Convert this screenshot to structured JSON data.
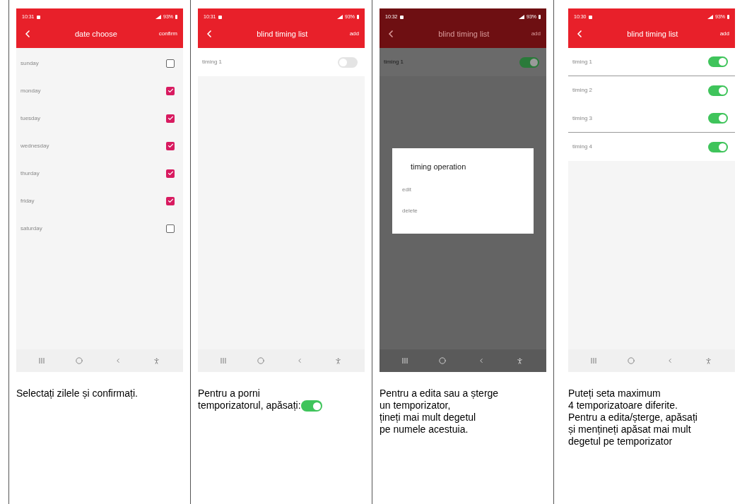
{
  "panels": [
    {
      "kind": "days",
      "dimmed": false,
      "status": {
        "time": "10:31",
        "battery": "93%"
      },
      "header": {
        "title": "date choose",
        "action": "confirm"
      },
      "days": [
        {
          "label": "sunday",
          "checked": false
        },
        {
          "label": "monday",
          "checked": true
        },
        {
          "label": "tuesday",
          "checked": true
        },
        {
          "label": "wednesday",
          "checked": true
        },
        {
          "label": "thurday",
          "checked": true
        },
        {
          "label": "friday",
          "checked": true
        },
        {
          "label": "saturday",
          "checked": false
        }
      ],
      "caption": "Selectați zilele și confirmați."
    },
    {
      "kind": "timers",
      "dimmed": false,
      "status": {
        "time": "10:31",
        "battery": "93%"
      },
      "header": {
        "title": "blind timing list",
        "action": "add"
      },
      "timers": [
        {
          "label": "timing 1",
          "on": false
        }
      ],
      "caption": "Pentru a porni\ntemporizatorul, apăsați:",
      "caption_toggle_on": true
    },
    {
      "kind": "timers",
      "dimmed": true,
      "status": {
        "time": "10:32",
        "battery": "93%"
      },
      "header": {
        "title": "blind timing list",
        "action": "add"
      },
      "timers": [
        {
          "label": "timing 1",
          "on": true
        }
      ],
      "dialog": {
        "title": "timing operation",
        "options": [
          "edit",
          "delete"
        ]
      },
      "caption": "Pentru a edita sau a șterge\nun temporizator,\nțineți mai mult degetul\npe numele acestuia."
    },
    {
      "kind": "timers",
      "dimmed": false,
      "status": {
        "time": "10:30",
        "battery": "93%"
      },
      "header": {
        "title": "blind timing list",
        "action": "add"
      },
      "timers": [
        {
          "label": "timing 1",
          "on": true
        },
        {
          "label": "timing 2",
          "on": true
        },
        {
          "label": "timing 3",
          "on": true
        },
        {
          "label": "timing 4",
          "on": true
        }
      ],
      "caption": "Puteți seta maximum\n4 temporizatoare diferite.\nPentru a edita/șterge, apăsați\nși mențineți apăsat mai mult\ndegetul pe temporizator"
    }
  ]
}
